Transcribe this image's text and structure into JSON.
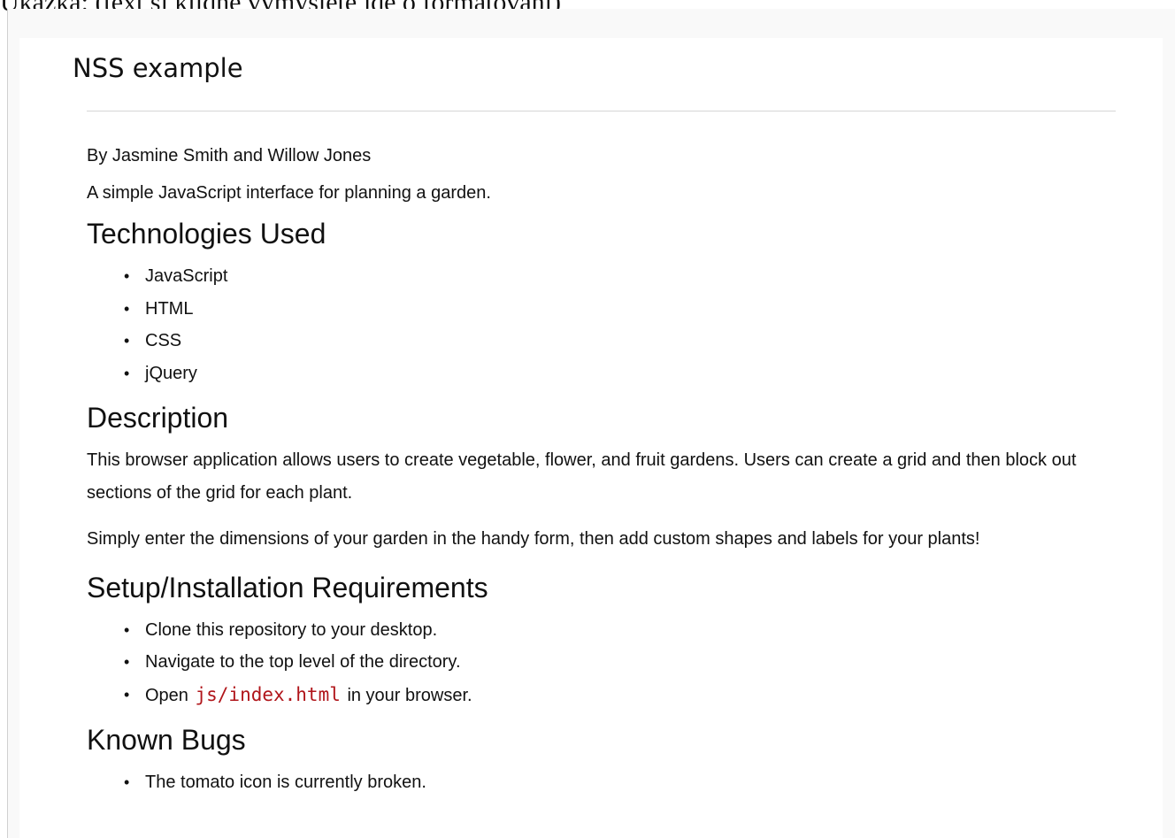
{
  "caption": "Ukázka: (text si klidně vymyslete jde o formátování)",
  "document": {
    "header": "NSS example",
    "authors": "By Jasmine Smith and Willow Jones",
    "summary": "A simple JavaScript interface for planning a garden.",
    "technologies": {
      "heading": "Technologies Used",
      "items": [
        "JavaScript",
        "HTML",
        "CSS",
        "jQuery"
      ]
    },
    "description": {
      "heading": "Description",
      "paragraphs": [
        "This browser application allows users to create vegetable, flower, and fruit gardens. Users can create a grid and then block out sections of the grid for each plant.",
        "Simply enter the dimensions of your garden in the handy form, then add custom shapes and labels for your plants!"
      ]
    },
    "setup": {
      "heading": "Setup/Installation Requirements",
      "items": [
        "Clone this repository to your desktop.",
        "Navigate to the top level of the directory."
      ],
      "open_item": {
        "before": "Open",
        "code": "js/index.html",
        "after": "in your browser."
      }
    },
    "bugs": {
      "heading": "Known Bugs",
      "items": [
        "The tomato icon is currently broken."
      ]
    }
  },
  "colors": {
    "code_text": "#b0151a",
    "rule": "#d6d6d6",
    "frame_bg": "#f9f9f9"
  }
}
